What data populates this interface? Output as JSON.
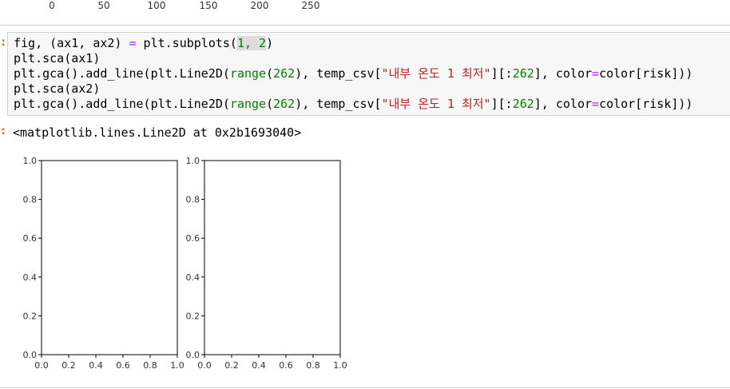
{
  "previous_axis": {
    "ticks": [
      "0",
      "50",
      "100",
      "150",
      "200",
      "250"
    ]
  },
  "cell": {
    "lines": [
      [
        {
          "t": "fig, (ax1, ax2) ",
          "c": ""
        },
        {
          "t": "=",
          "c": "op"
        },
        {
          "t": " plt.subplots(",
          "c": ""
        },
        {
          "t": "1, 2",
          "c": "num hl"
        },
        {
          "t": ")",
          "c": ""
        }
      ],
      [
        {
          "t": "plt.sca(ax1)",
          "c": ""
        }
      ],
      [
        {
          "t": "plt.gca().add_line(plt.Line2D(",
          "c": ""
        },
        {
          "t": "range",
          "c": "kw"
        },
        {
          "t": "(",
          "c": ""
        },
        {
          "t": "262",
          "c": "num"
        },
        {
          "t": "), temp_csv[",
          "c": ""
        },
        {
          "t": "\"내부 온도 1 최저\"",
          "c": "str"
        },
        {
          "t": "][:",
          "c": ""
        },
        {
          "t": "262",
          "c": "num"
        },
        {
          "t": "], color",
          "c": ""
        },
        {
          "t": "=",
          "c": "op"
        },
        {
          "t": "color[risk]))",
          "c": ""
        }
      ],
      [
        {
          "t": "plt.sca(ax2)",
          "c": ""
        }
      ],
      [
        {
          "t": "plt.gca().add_line(plt.Line2D(",
          "c": ""
        },
        {
          "t": "range",
          "c": "kw"
        },
        {
          "t": "(",
          "c": ""
        },
        {
          "t": "262",
          "c": "num"
        },
        {
          "t": "), temp_csv[",
          "c": ""
        },
        {
          "t": "\"내부 온도 1 최저\"",
          "c": "str"
        },
        {
          "t": "][:",
          "c": ""
        },
        {
          "t": "262",
          "c": "num"
        },
        {
          "t": "], color",
          "c": ""
        },
        {
          "t": "=",
          "c": "op"
        },
        {
          "t": "color[risk]))",
          "c": ""
        }
      ]
    ]
  },
  "output": {
    "text": "<matplotlib.lines.Line2D at 0x2b1693040>"
  },
  "chart_data": [
    {
      "type": "line",
      "x": [],
      "series": [],
      "xlim": [
        0.0,
        1.0
      ],
      "ylim": [
        0.0,
        1.0
      ],
      "xticks": [
        "0.0",
        "0.2",
        "0.4",
        "0.6",
        "0.8",
        "1.0"
      ],
      "yticks": [
        "0.0",
        "0.2",
        "0.4",
        "0.6",
        "0.8",
        "1.0"
      ],
      "grid": false
    },
    {
      "type": "line",
      "x": [],
      "series": [],
      "xlim": [
        0.0,
        1.0
      ],
      "ylim": [
        0.0,
        1.0
      ],
      "xticks": [
        "0.0",
        "0.2",
        "0.4",
        "0.6",
        "0.8",
        "1.0"
      ],
      "yticks": [
        "0.0",
        "0.2",
        "0.4",
        "0.6",
        "0.8",
        "1.0"
      ],
      "grid": false
    }
  ],
  "colors": {
    "prompt": "#e85b2a",
    "keyword": "#008000",
    "string": "#ba2121",
    "operator": "#aa22ff"
  }
}
